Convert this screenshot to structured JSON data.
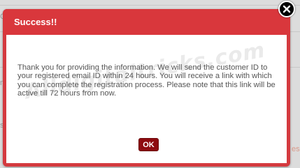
{
  "background": {
    "fragments": [
      "C",
      "nt",
      "s"
    ],
    "link_fragment": "es"
  },
  "modal": {
    "title": "Success!!",
    "message": "Thank you for providing the information. We will send the customer ID to your registered email ID within 24 hours. You will receive a link with which you can complete the registration process. Please note that this link will be active till 72 hours from now.",
    "ok_label": "OK",
    "watermark": "Alldigitaltricks.com",
    "close_icon": "close-icon"
  },
  "colors": {
    "header": "#d9373c",
    "ok_button": "#8e0b10",
    "close_button": "#000000"
  }
}
